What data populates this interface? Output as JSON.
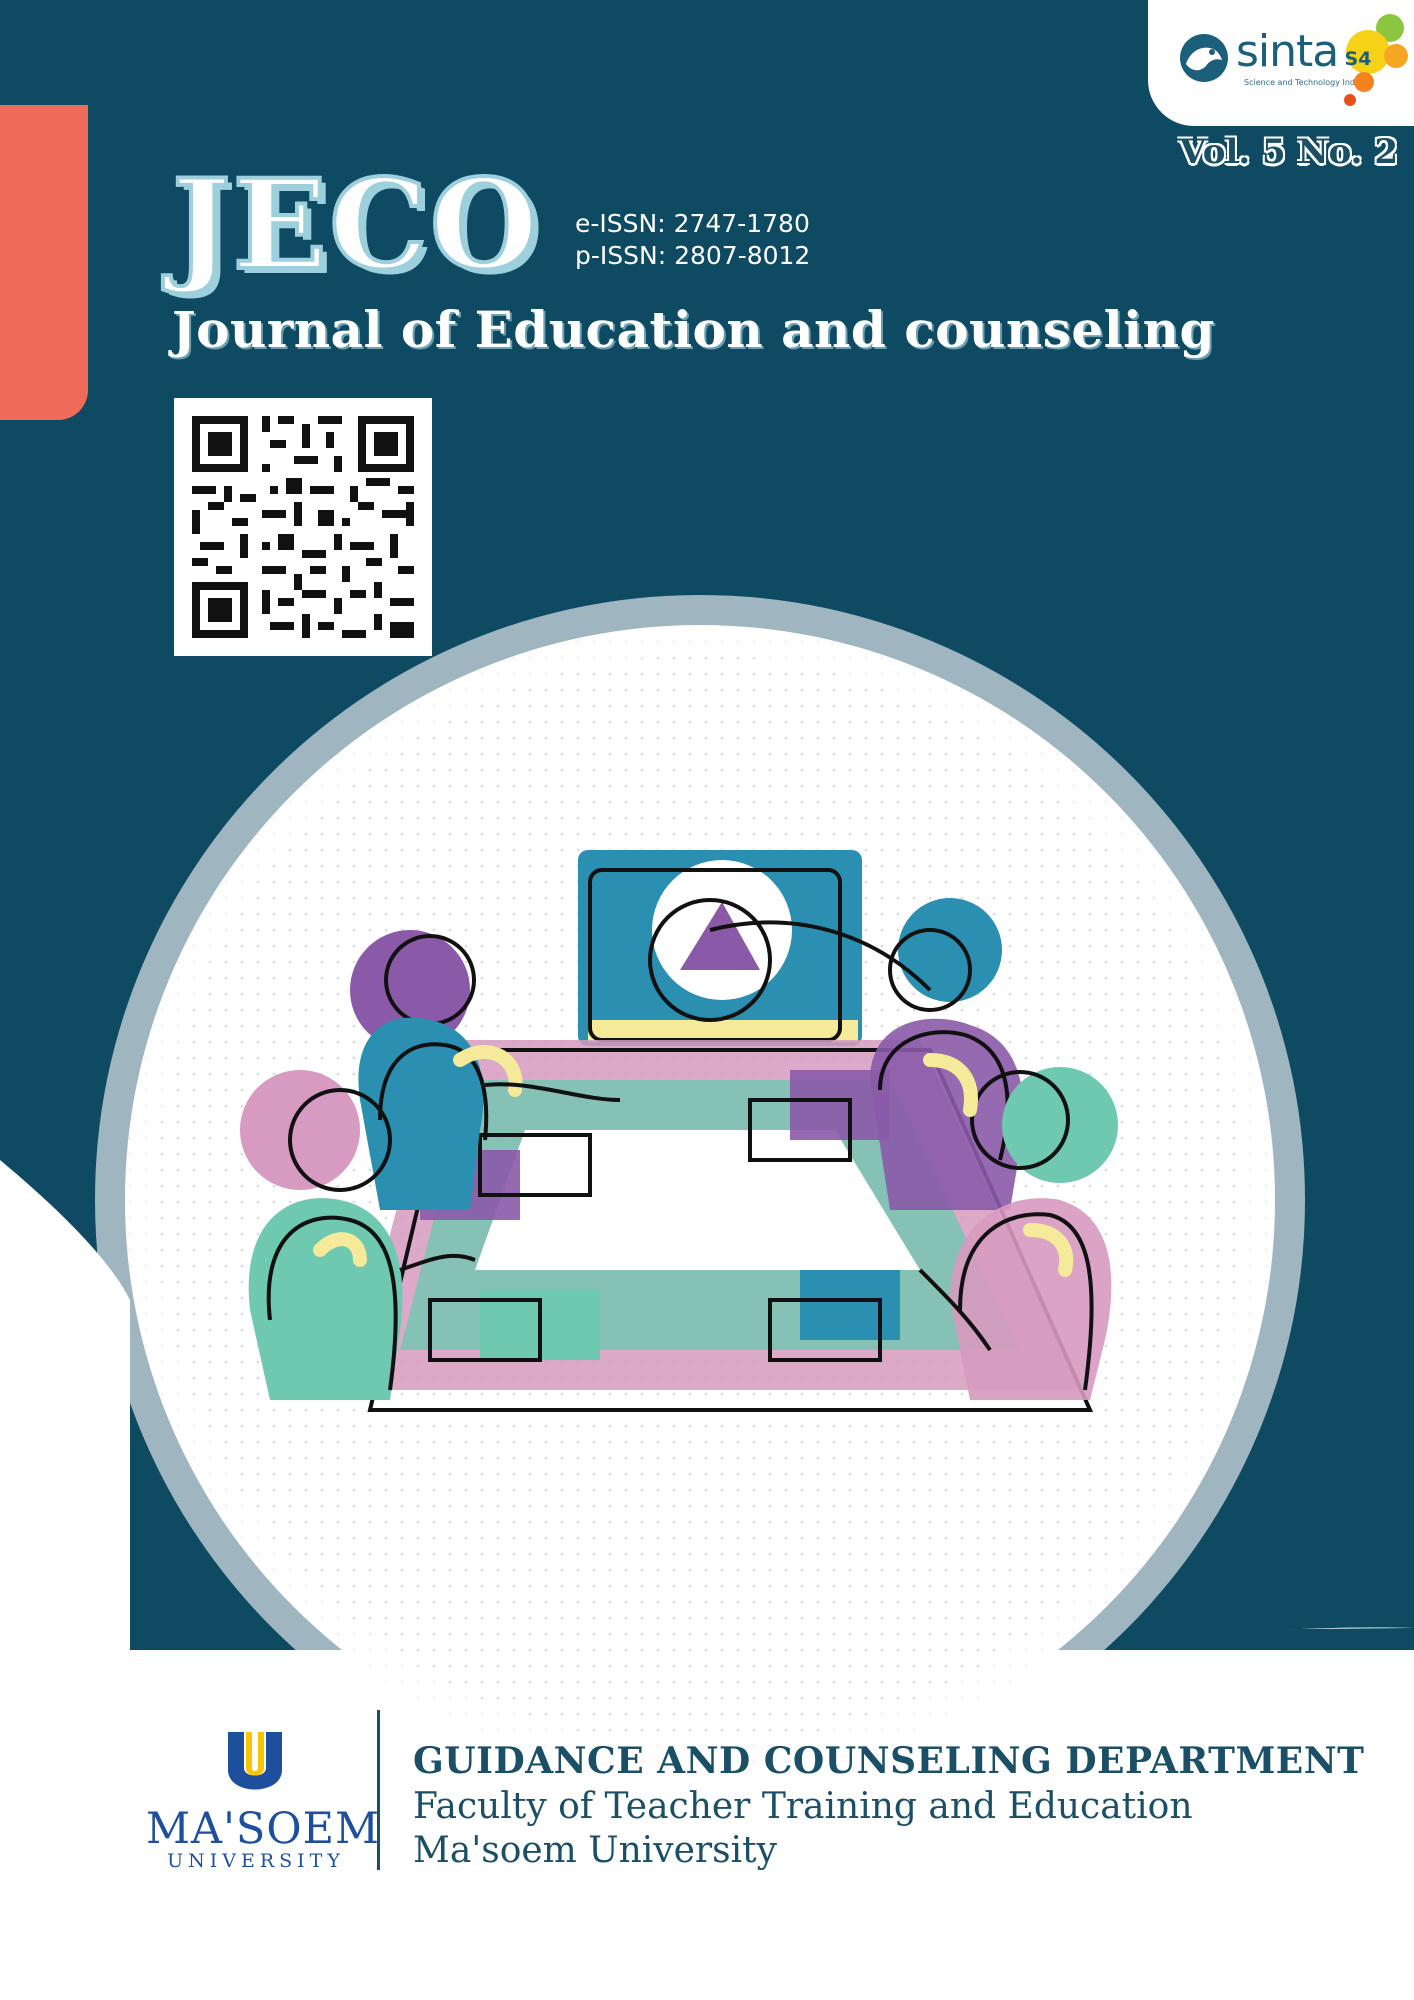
{
  "journal": {
    "acronym": "JECO",
    "title": "Journal of Education and counseling",
    "e_issn": "e-ISSN: 2747-1780",
    "p_issn": "p-ISSN: 2807-8012",
    "volume": "Vol. 5 No. 2"
  },
  "sinta": {
    "wordmark": "sinta",
    "subtitle": "Science and Technology Index",
    "grade": "S4"
  },
  "publisher": {
    "university_name": "MA'SOEM",
    "university_sub": "UNIVERSITY",
    "department": "GUIDANCE AND COUNSELING DEPARTMENT",
    "faculty": "Faculty of Teacher Training and Education",
    "university": "Ma'soem University"
  },
  "colors": {
    "background": "#0f4a63",
    "coral": "#ef6b5a",
    "teal": "#2a8fb0",
    "mint": "#6fc8b0",
    "purple": "#8a5aa8",
    "pink": "#d79ac0",
    "yellow": "#f4ea9a",
    "navy_text": "#1b4f66"
  }
}
